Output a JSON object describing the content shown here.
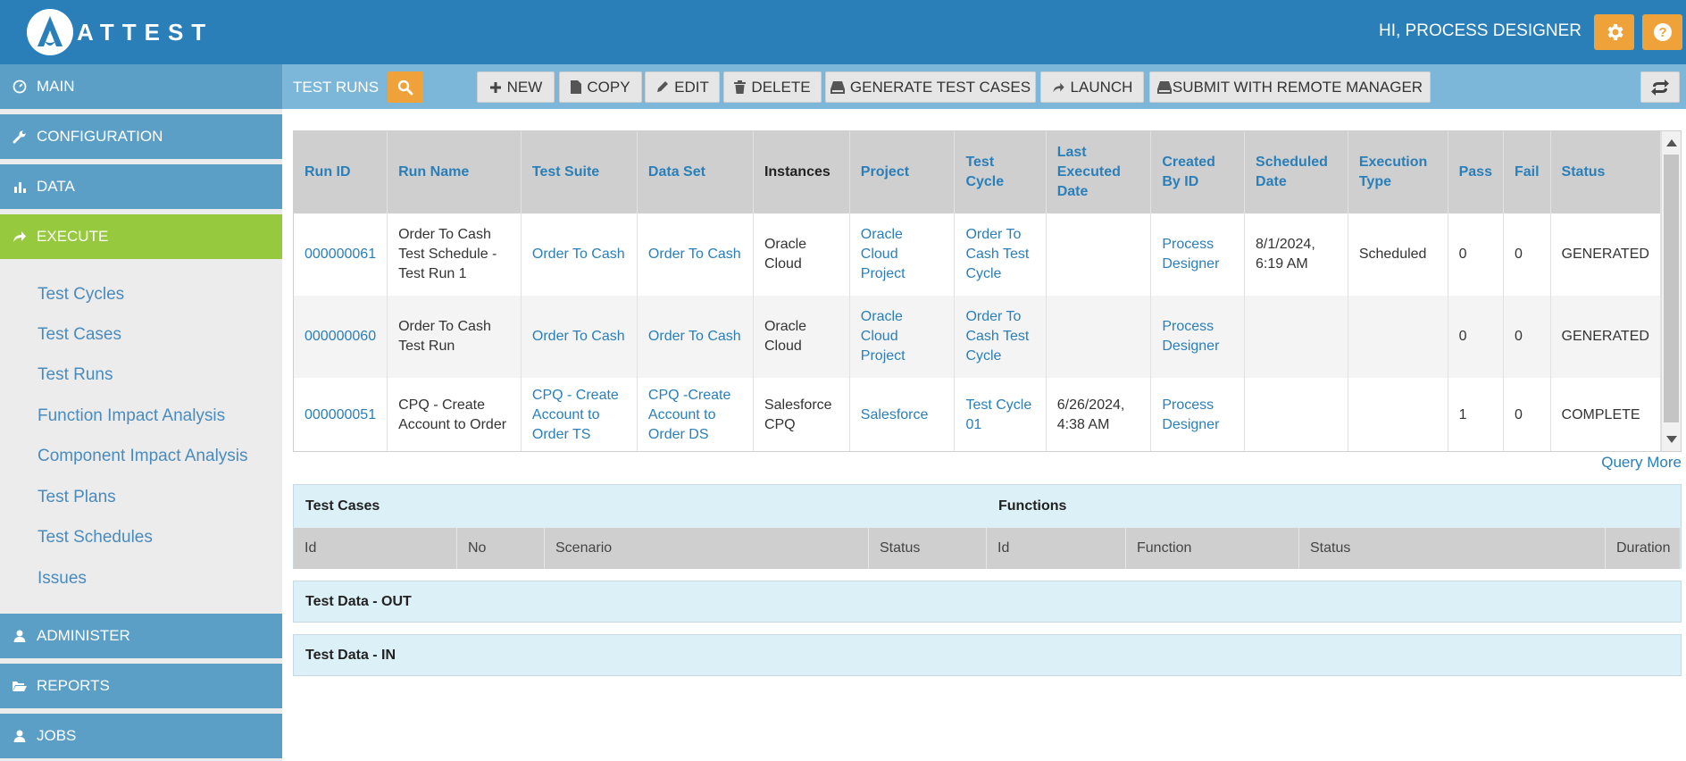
{
  "header": {
    "logo_text": "ATTEST",
    "greeting": "HI, PROCESS DESIGNER",
    "settings_icon": "gear-icon",
    "help_icon": "question-icon"
  },
  "sidebar": {
    "sections": [
      {
        "label": "MAIN",
        "icon": "dashboard-icon"
      },
      {
        "label": "CONFIGURATION",
        "icon": "wrench-icon"
      },
      {
        "label": "DATA",
        "icon": "bar-chart-icon"
      },
      {
        "label": "EXECUTE",
        "icon": "share-arrow-icon"
      },
      {
        "label": "ADMINISTER",
        "icon": "user-icon"
      },
      {
        "label": "REPORTS",
        "icon": "folder-open-icon"
      },
      {
        "label": "JOBS",
        "icon": "user-icon"
      }
    ],
    "execute_items": [
      "Test Cycles",
      "Test Cases",
      "Test Runs",
      "Function Impact Analysis",
      "Component Impact Analysis",
      "Test Plans",
      "Test Schedules",
      "Issues"
    ]
  },
  "toolbar": {
    "title": "TEST RUNS",
    "buttons": [
      {
        "label": "NEW",
        "icon": "plus-icon"
      },
      {
        "label": "COPY",
        "icon": "file-icon"
      },
      {
        "label": "EDIT",
        "icon": "pencil-icon"
      },
      {
        "label": "DELETE",
        "icon": "trash-icon"
      },
      {
        "label": "GENERATE TEST CASES",
        "icon": "hdd-icon"
      },
      {
        "label": "LAUNCH",
        "icon": "share-arrow-icon"
      },
      {
        "label": "SUBMIT WITH REMOTE MANAGER",
        "icon": "hdd-icon"
      }
    ]
  },
  "runs": {
    "columns": [
      "Run ID",
      "Run Name",
      "Test Suite",
      "Data Set",
      "Instances",
      "Project",
      "Test Cycle",
      "Last Executed Date",
      "Created By ID",
      "Scheduled Date",
      "Execution Type",
      "Pass",
      "Fail",
      "Status"
    ],
    "rows": [
      {
        "run_id": "000000061",
        "run_name": "Order To Cash Test Schedule - Test Run 1",
        "test_suite": "Order To Cash",
        "data_set": "Order To Cash",
        "instances": "Oracle Cloud",
        "project": "Oracle Cloud Project",
        "test_cycle": "Order To Cash Test Cycle",
        "last_executed": "",
        "created_by": "Process Designer",
        "scheduled_date": "8/1/2024, 6:19 AM",
        "execution_type": "Scheduled",
        "pass": "0",
        "fail": "0",
        "status": "GENERATED"
      },
      {
        "run_id": "000000060",
        "run_name": "Order To Cash Test Run",
        "test_suite": "Order To Cash",
        "data_set": "Order To Cash",
        "instances": "Oracle Cloud",
        "project": "Oracle Cloud Project",
        "test_cycle": "Order To Cash Test Cycle",
        "last_executed": "",
        "created_by": "Process Designer",
        "scheduled_date": "",
        "execution_type": "",
        "pass": "0",
        "fail": "0",
        "status": "GENERATED"
      },
      {
        "run_id": "000000051",
        "run_name": "CPQ - Create Account to Order",
        "test_suite": "CPQ - Create Account to Order TS",
        "data_set": "CPQ -Create Account to Order DS",
        "instances": "Salesforce CPQ",
        "project": "Salesforce",
        "test_cycle": "Test Cycle 01",
        "last_executed": "6/26/2024, 4:38 AM",
        "created_by": "Process Designer",
        "scheduled_date": "",
        "execution_type": "",
        "pass": "1",
        "fail": "0",
        "status": "COMPLETE"
      }
    ],
    "query_more": "Query More"
  },
  "test_cases_panel": {
    "title": "Test Cases",
    "columns": [
      "Id",
      "No",
      "Scenario",
      "Status"
    ]
  },
  "functions_panel": {
    "title": "Functions",
    "columns": [
      "Id",
      "Function",
      "Status",
      "Duration"
    ]
  },
  "test_data_out": {
    "title": "Test Data - OUT"
  },
  "test_data_in": {
    "title": "Test Data - IN"
  }
}
